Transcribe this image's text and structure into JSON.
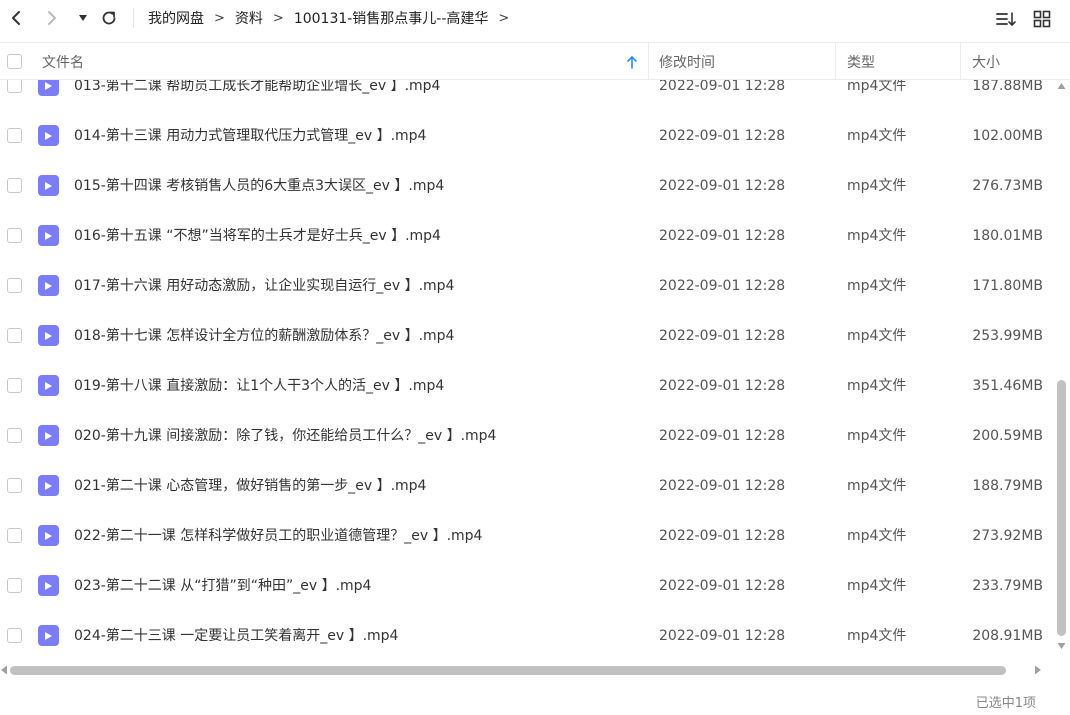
{
  "nav": {
    "back_icon": "chevron-left-icon",
    "forward_icon": "chevron-right-icon",
    "dropdown_icon": "caret-down-icon",
    "refresh_icon": "refresh-icon",
    "sort_icon": "sort-list-icon",
    "grid_icon": "grid-view-icon"
  },
  "breadcrumb": {
    "items": [
      "我的网盘",
      "资料",
      "100131-销售那点事儿--高建华"
    ],
    "separator": ">"
  },
  "header": {
    "name": "文件名",
    "modified": "修改时间",
    "type": "类型",
    "size": "大小",
    "sort_indicator_color": "#2f8cff"
  },
  "files": [
    {
      "name": "013-第十二课  帮助员工成长才能帮助企业增长_ev 】.mp4",
      "modified": "2022-09-01 12:28",
      "type": "mp4文件",
      "size": "187.88MB"
    },
    {
      "name": "014-第十三课 用动力式管理取代压力式管理_ev 】.mp4",
      "modified": "2022-09-01 12:28",
      "type": "mp4文件",
      "size": "102.00MB"
    },
    {
      "name": "015-第十四课 考核销售人员的6大重点3大误区_ev 】.mp4",
      "modified": "2022-09-01 12:28",
      "type": "mp4文件",
      "size": "276.73MB"
    },
    {
      "name": "016-第十五课 “不想”当将军的士兵才是好士兵_ev 】.mp4",
      "modified": "2022-09-01 12:28",
      "type": "mp4文件",
      "size": "180.01MB"
    },
    {
      "name": "017-第十六课    用好动态激励，让企业实现自运行_ev 】.mp4",
      "modified": "2022-09-01 12:28",
      "type": "mp4文件",
      "size": "171.80MB"
    },
    {
      "name": "018-第十七课 怎样设计全方位的薪酬激励体系？_ev 】.mp4",
      "modified": "2022-09-01 12:28",
      "type": "mp4文件",
      "size": "253.99MB"
    },
    {
      "name": "019-第十八课 直接激励：让1个人干3个人的活_ev 】.mp4",
      "modified": "2022-09-01 12:28",
      "type": "mp4文件",
      "size": "351.46MB"
    },
    {
      "name": "020-第十九课 间接激励：除了钱，你还能给员工什么？_ev 】.mp4",
      "modified": "2022-09-01 12:28",
      "type": "mp4文件",
      "size": "200.59MB"
    },
    {
      "name": "021-第二十课 心态管理，做好销售的第一步_ev 】.mp4",
      "modified": "2022-09-01 12:28",
      "type": "mp4文件",
      "size": "188.79MB"
    },
    {
      "name": "022-第二十一课 怎样科学做好员工的职业道德管理？_ev 】.mp4",
      "modified": "2022-09-01 12:28",
      "type": "mp4文件",
      "size": "273.92MB"
    },
    {
      "name": "023-第二十二课  从“打猎”到“种田”_ev 】.mp4",
      "modified": "2022-09-01 12:28",
      "type": "mp4文件",
      "size": "233.79MB"
    },
    {
      "name": "024-第二十三课  一定要让员工笑着离开_ev 】.mp4",
      "modified": "2022-09-01 12:28",
      "type": "mp4文件",
      "size": "208.91MB"
    }
  ],
  "file_icon": "video-file-icon",
  "file_icon_color": "#7a7df5",
  "status": "已选中1项"
}
